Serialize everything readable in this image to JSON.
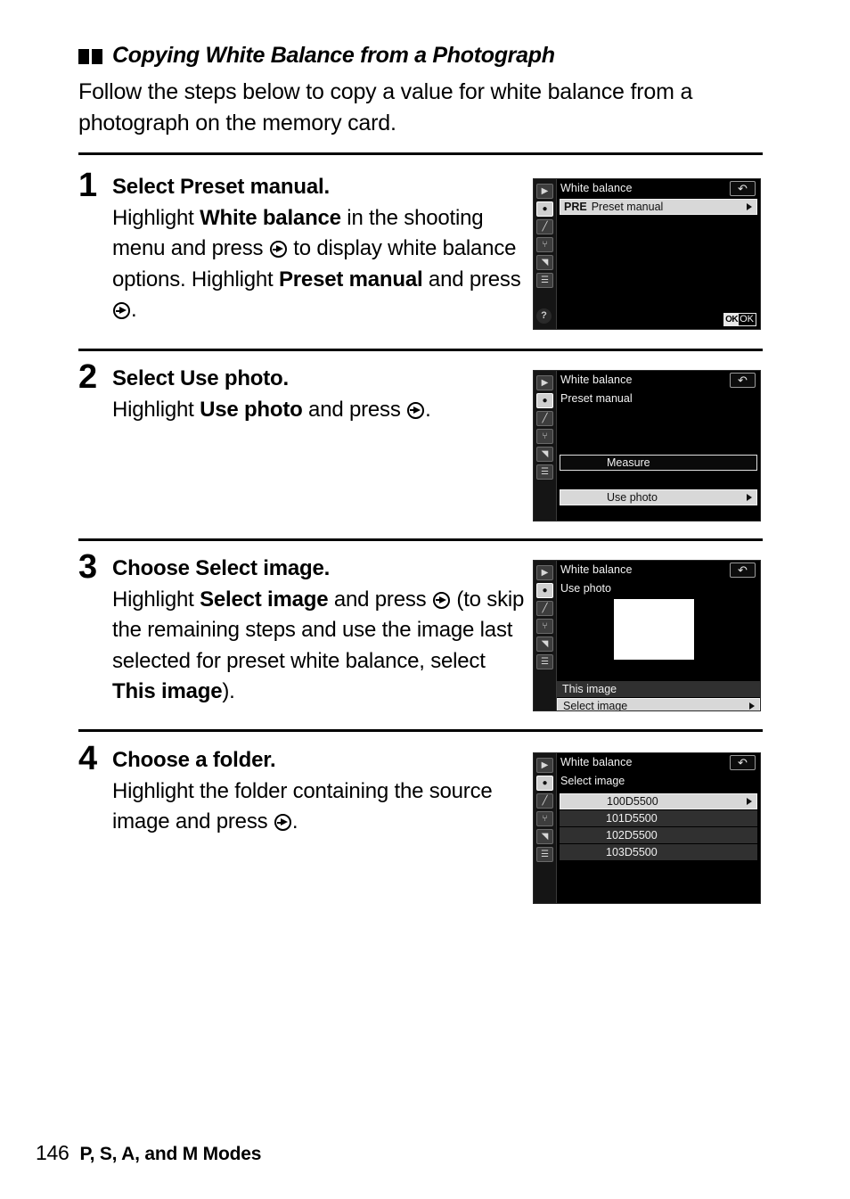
{
  "heading": {
    "marker": "double-square-marker",
    "title": "Copying White Balance from a Photograph"
  },
  "intro": "Follow the steps below to copy a value for white balance from a photograph on the memory card.",
  "steps": [
    {
      "number": "1",
      "title_prefix": "Select ",
      "title_bold": "Preset manual",
      "title_suffix": ".",
      "body_parts": [
        {
          "t": "Highlight "
        },
        {
          "t": "White balance",
          "b": true
        },
        {
          "t": " in the shooting menu and press "
        },
        {
          "icon": "multi-selector-right-icon"
        },
        {
          "t": " to display white balance options.  Highlight "
        },
        {
          "t": "Preset manual",
          "b": true
        },
        {
          "t": " and press "
        },
        {
          "icon": "multi-selector-right-icon"
        },
        {
          "t": "."
        }
      ]
    },
    {
      "number": "2",
      "title_prefix": "Select ",
      "title_bold": "Use photo",
      "title_suffix": ".",
      "body_parts": [
        {
          "t": "Highlight "
        },
        {
          "t": "Use photo",
          "b": true
        },
        {
          "t": " and press "
        },
        {
          "icon": "multi-selector-right-icon"
        },
        {
          "t": "."
        }
      ]
    },
    {
      "number": "3",
      "title_prefix": "Choose ",
      "title_bold": "Select image",
      "title_suffix": ".",
      "body_parts": [
        {
          "t": "Highlight "
        },
        {
          "t": "Select image",
          "b": true
        },
        {
          "t": " and press "
        },
        {
          "icon": "multi-selector-right-icon"
        },
        {
          "t": " (to skip the remaining steps and use the image last selected for preset white balance, select "
        },
        {
          "t": "This image",
          "b": true
        },
        {
          "t": ")."
        }
      ]
    },
    {
      "number": "4",
      "title_prefix": "Choose a folder",
      "title_bold": "",
      "title_suffix": ".",
      "body_parts": [
        {
          "t": "Highlight the folder containing the source image and press "
        },
        {
          "icon": "multi-selector-right-icon"
        },
        {
          "t": "."
        }
      ]
    }
  ],
  "lcd_sidebar_icons": [
    {
      "name": "playback-icon",
      "glyph": "▶"
    },
    {
      "name": "shooting-menu-icon",
      "glyph": "●",
      "active": true
    },
    {
      "name": "custom-settings-icon",
      "glyph": "╱"
    },
    {
      "name": "setup-menu-icon",
      "glyph": "⑂"
    },
    {
      "name": "retouch-menu-icon",
      "glyph": "◥"
    },
    {
      "name": "recent-settings-icon",
      "glyph": "☰"
    }
  ],
  "lcd_help_icon": "?",
  "lcd_back_icon": "↶",
  "screens": [
    {
      "id": "screen-preset-manual",
      "title": "White balance",
      "rows": [
        {
          "badge": "PRE",
          "label": "Preset manual",
          "state": "selected",
          "arrow": true
        }
      ],
      "ok_badge": "OK",
      "ok_label": "OK"
    },
    {
      "id": "screen-use-photo",
      "title": "White balance",
      "subtitle": "Preset manual",
      "rows": [
        {
          "label": "Measure",
          "state": "outline",
          "arrow": false
        },
        {
          "label": "Use photo",
          "state": "selected",
          "arrow": true
        }
      ]
    },
    {
      "id": "screen-select-image",
      "title": "White balance",
      "subtitle": "Use photo",
      "thumbnail": "photo-thumbnail",
      "rows": [
        {
          "label": "This image",
          "state": "dim",
          "arrow": false
        },
        {
          "label": "Select image",
          "state": "selected",
          "arrow": true
        }
      ]
    },
    {
      "id": "screen-choose-folder",
      "title": "White balance",
      "subtitle": "Select image",
      "rows": [
        {
          "label": "100D5500",
          "state": "selected",
          "arrow": true
        },
        {
          "label": "101D5500",
          "state": "dim",
          "arrow": false
        },
        {
          "label": "102D5500",
          "state": "dim",
          "arrow": false
        },
        {
          "label": "103D5500",
          "state": "dim",
          "arrow": false
        }
      ]
    }
  ],
  "footer": {
    "page_number": "146",
    "section_title": "P, S, A, and M Modes"
  }
}
